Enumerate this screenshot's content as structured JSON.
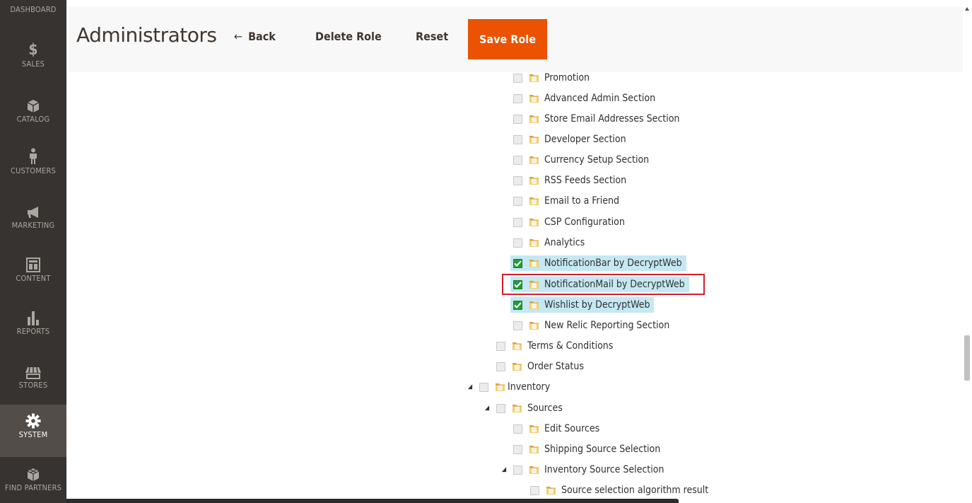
{
  "sidebar": {
    "items": [
      {
        "label": "DASHBOARD",
        "icon": "dashboard-icon"
      },
      {
        "label": "SALES",
        "icon": "dollar-icon"
      },
      {
        "label": "CATALOG",
        "icon": "box-icon"
      },
      {
        "label": "CUSTOMERS",
        "icon": "person-icon"
      },
      {
        "label": "MARKETING",
        "icon": "megaphone-icon"
      },
      {
        "label": "CONTENT",
        "icon": "layout-icon"
      },
      {
        "label": "REPORTS",
        "icon": "bar-chart-icon"
      },
      {
        "label": "STORES",
        "icon": "store-icon"
      },
      {
        "label": "SYSTEM",
        "icon": "gear-icon"
      },
      {
        "label": "FIND PARTNERS",
        "icon": "cubes-icon"
      }
    ],
    "active": "SYSTEM"
  },
  "header": {
    "title": "Administrators",
    "back_label": "Back",
    "delete_label": "Delete Role",
    "reset_label": "Reset",
    "save_label": "Save Role"
  },
  "tree": {
    "nodes": [
      {
        "label": "Promotion",
        "checked": false
      },
      {
        "label": "Advanced Admin Section",
        "checked": false
      },
      {
        "label": "Store Email Addresses Section",
        "checked": false
      },
      {
        "label": "Developer Section",
        "checked": false
      },
      {
        "label": "Currency Setup Section",
        "checked": false
      },
      {
        "label": "RSS Feeds Section",
        "checked": false
      },
      {
        "label": "Email to a Friend",
        "checked": false
      },
      {
        "label": "CSP Configuration",
        "checked": false
      },
      {
        "label": "Analytics",
        "checked": false
      },
      {
        "label": "NotificationBar by DecryptWeb",
        "checked": true
      },
      {
        "label": "NotificationMail by DecryptWeb",
        "checked": true
      },
      {
        "label": "Wishlist by DecryptWeb",
        "checked": true
      },
      {
        "label": "New Relic Reporting Section",
        "checked": false
      },
      {
        "label": "Terms & Conditions",
        "checked": false
      },
      {
        "label": "Order Status",
        "checked": false
      },
      {
        "label": "Inventory",
        "checked": false,
        "expanded": true
      },
      {
        "label": "Sources",
        "checked": false,
        "expanded": true
      },
      {
        "label": "Edit Sources",
        "checked": false
      },
      {
        "label": "Shipping Source Selection",
        "checked": false
      },
      {
        "label": "Inventory Source Selection",
        "checked": false,
        "expanded": true
      },
      {
        "label": "Source selection algorithm result",
        "checked": false
      }
    ]
  },
  "colors": {
    "sidebar_bg": "#373330",
    "sidebar_active_bg": "#524d49",
    "save_button": "#eb5202",
    "highlight_row": "#c5e8f3",
    "highlight_box": "#d0202e",
    "checkbox_checked": "#1f9e34"
  }
}
